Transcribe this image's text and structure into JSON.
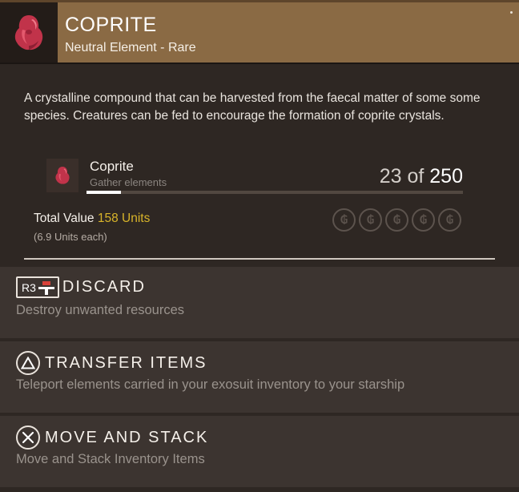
{
  "item": {
    "name": "COPRITE",
    "category": "Neutral Element - Rare",
    "description": "A crystalline compound that can be harvested from the faecal matter of some some species. Creatures can be fed to encourage the formation of coprite crystals.",
    "icon": "coprite-crystal-icon",
    "accent_color": "#8a6a44"
  },
  "resource": {
    "name": "Coprite",
    "hint": "Gather elements",
    "current": "23",
    "separator": "of",
    "max": "250",
    "progress": 0.092
  },
  "value": {
    "label": "Total Value",
    "units": "158 Units",
    "each": "(6.9 Units each)",
    "unit_icons": [
      "units-icon",
      "units-icon",
      "units-icon",
      "units-icon",
      "units-icon"
    ],
    "units_color": "#d8b42a"
  },
  "actions": [
    {
      "button": "R3",
      "button_icon": "r3-stick-icon",
      "label": "DISCARD",
      "description": "Destroy unwanted resources"
    },
    {
      "button_icon": "triangle-button-icon",
      "label": "TRANSFER ITEMS",
      "description": "Teleport elements carried in your exosuit inventory to your starship"
    },
    {
      "button_icon": "cross-button-icon",
      "label": "MOVE AND STACK",
      "description": "Move and Stack Inventory Items"
    }
  ]
}
